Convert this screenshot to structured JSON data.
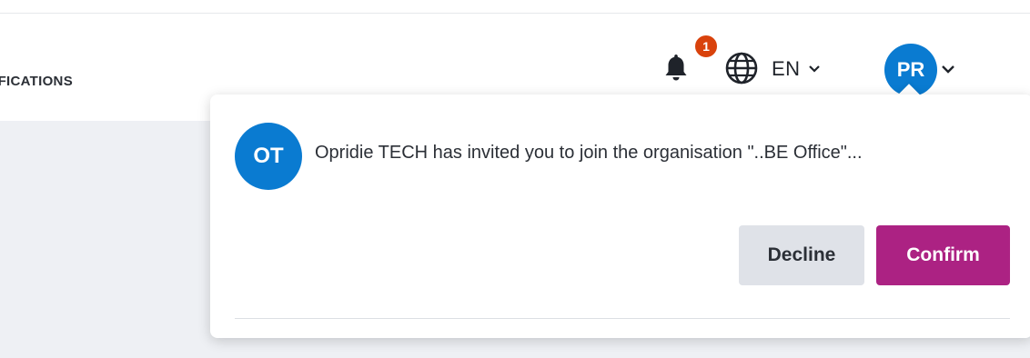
{
  "header": {
    "nav_item_label": "NOTIFICATIONS",
    "notification_count": "1",
    "language": "EN",
    "user_initials": "PR"
  },
  "notification_popover": {
    "items": [
      {
        "avatar_initials": "OT",
        "message": "Opridie TECH has invited you to join the organisation \"..BE Office\"...",
        "decline_label": "Decline",
        "confirm_label": "Confirm"
      }
    ]
  },
  "colors": {
    "brand_blue": "#0a7bd1",
    "badge_orange": "#d9420c",
    "confirm_magenta": "#ac2283",
    "decline_gray": "#dfe2e8"
  }
}
